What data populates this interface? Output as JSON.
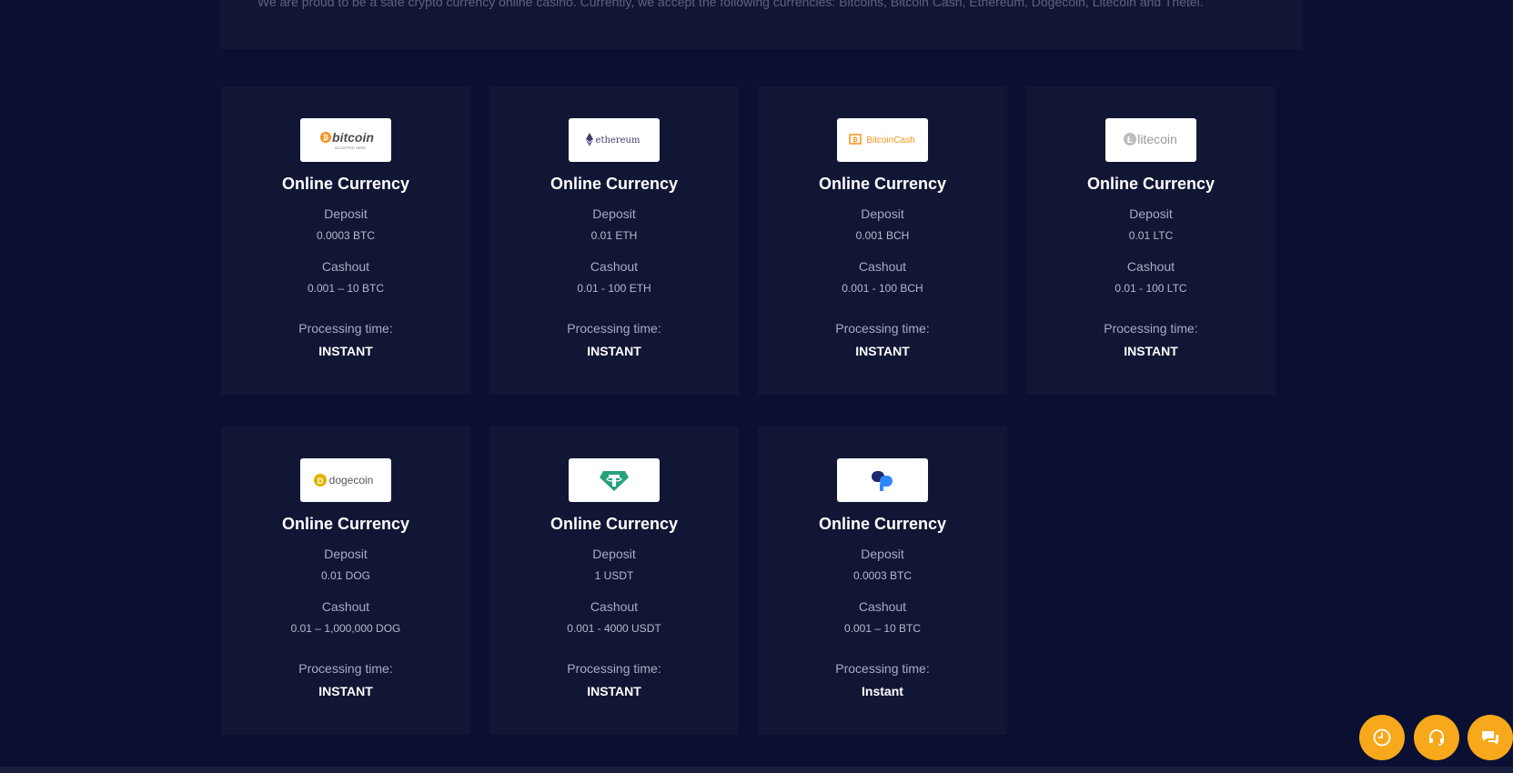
{
  "intro": {
    "text": "We are proud to be a safe crypto currency online casino. Currently, we accept the following currencies: Bitcoins, Bitcoin Cash, Ethereum, Dogecoin, Litecoin and Thetel."
  },
  "labels": {
    "deposit": "Deposit",
    "cashout": "Cashout",
    "processing": "Processing time:"
  },
  "cards": [
    {
      "logo_name": "bitcoin-logo",
      "logo_text": "bitcoin",
      "logo_sub": "ACCEPTED HERE",
      "title": "Online Currency",
      "deposit": "0.0003 BTC",
      "cashout": "0.001 – 10 BTC",
      "processing": "INSTANT"
    },
    {
      "logo_name": "ethereum-logo",
      "logo_text": "ethereum",
      "title": "Online Currency",
      "deposit": "0.01 ETH",
      "cashout": "0.01 - 100 ETH",
      "processing": "INSTANT"
    },
    {
      "logo_name": "bitcoin-cash-logo",
      "logo_text": "BitcoinCash",
      "title": "Online Currency",
      "deposit": "0.001 BCH",
      "cashout": "0.001 - 100 BCH",
      "processing": "INSTANT"
    },
    {
      "logo_name": "litecoin-logo",
      "logo_text": "litecoin",
      "title": "Online Currency",
      "deposit": "0.01 LTC",
      "cashout": "0.01 - 100 LTC",
      "processing": "INSTANT"
    },
    {
      "logo_name": "dogecoin-logo",
      "logo_text": "dogecoin",
      "title": "Online Currency",
      "deposit": "0.01 DOG",
      "cashout": "0.01 – 1,000,000 DOG",
      "processing": "INSTANT"
    },
    {
      "logo_name": "tether-logo",
      "logo_text": "",
      "title": "Online Currency",
      "deposit": "1 USDT",
      "cashout": "0.001 - 4000 USDT",
      "processing": "INSTANT"
    },
    {
      "logo_name": "coinspaid-logo",
      "logo_text": "",
      "title": "Online Currency",
      "deposit": "0.0003 BTC",
      "cashout": "0.001 – 10 BTC",
      "processing": "Instant"
    }
  ],
  "floating_buttons": [
    {
      "icon": "clock-icon"
    },
    {
      "icon": "headset-icon"
    },
    {
      "icon": "chat-icon"
    }
  ],
  "colors": {
    "background": "#0b1033",
    "card": "#111634",
    "accent": "#f7a81b"
  }
}
